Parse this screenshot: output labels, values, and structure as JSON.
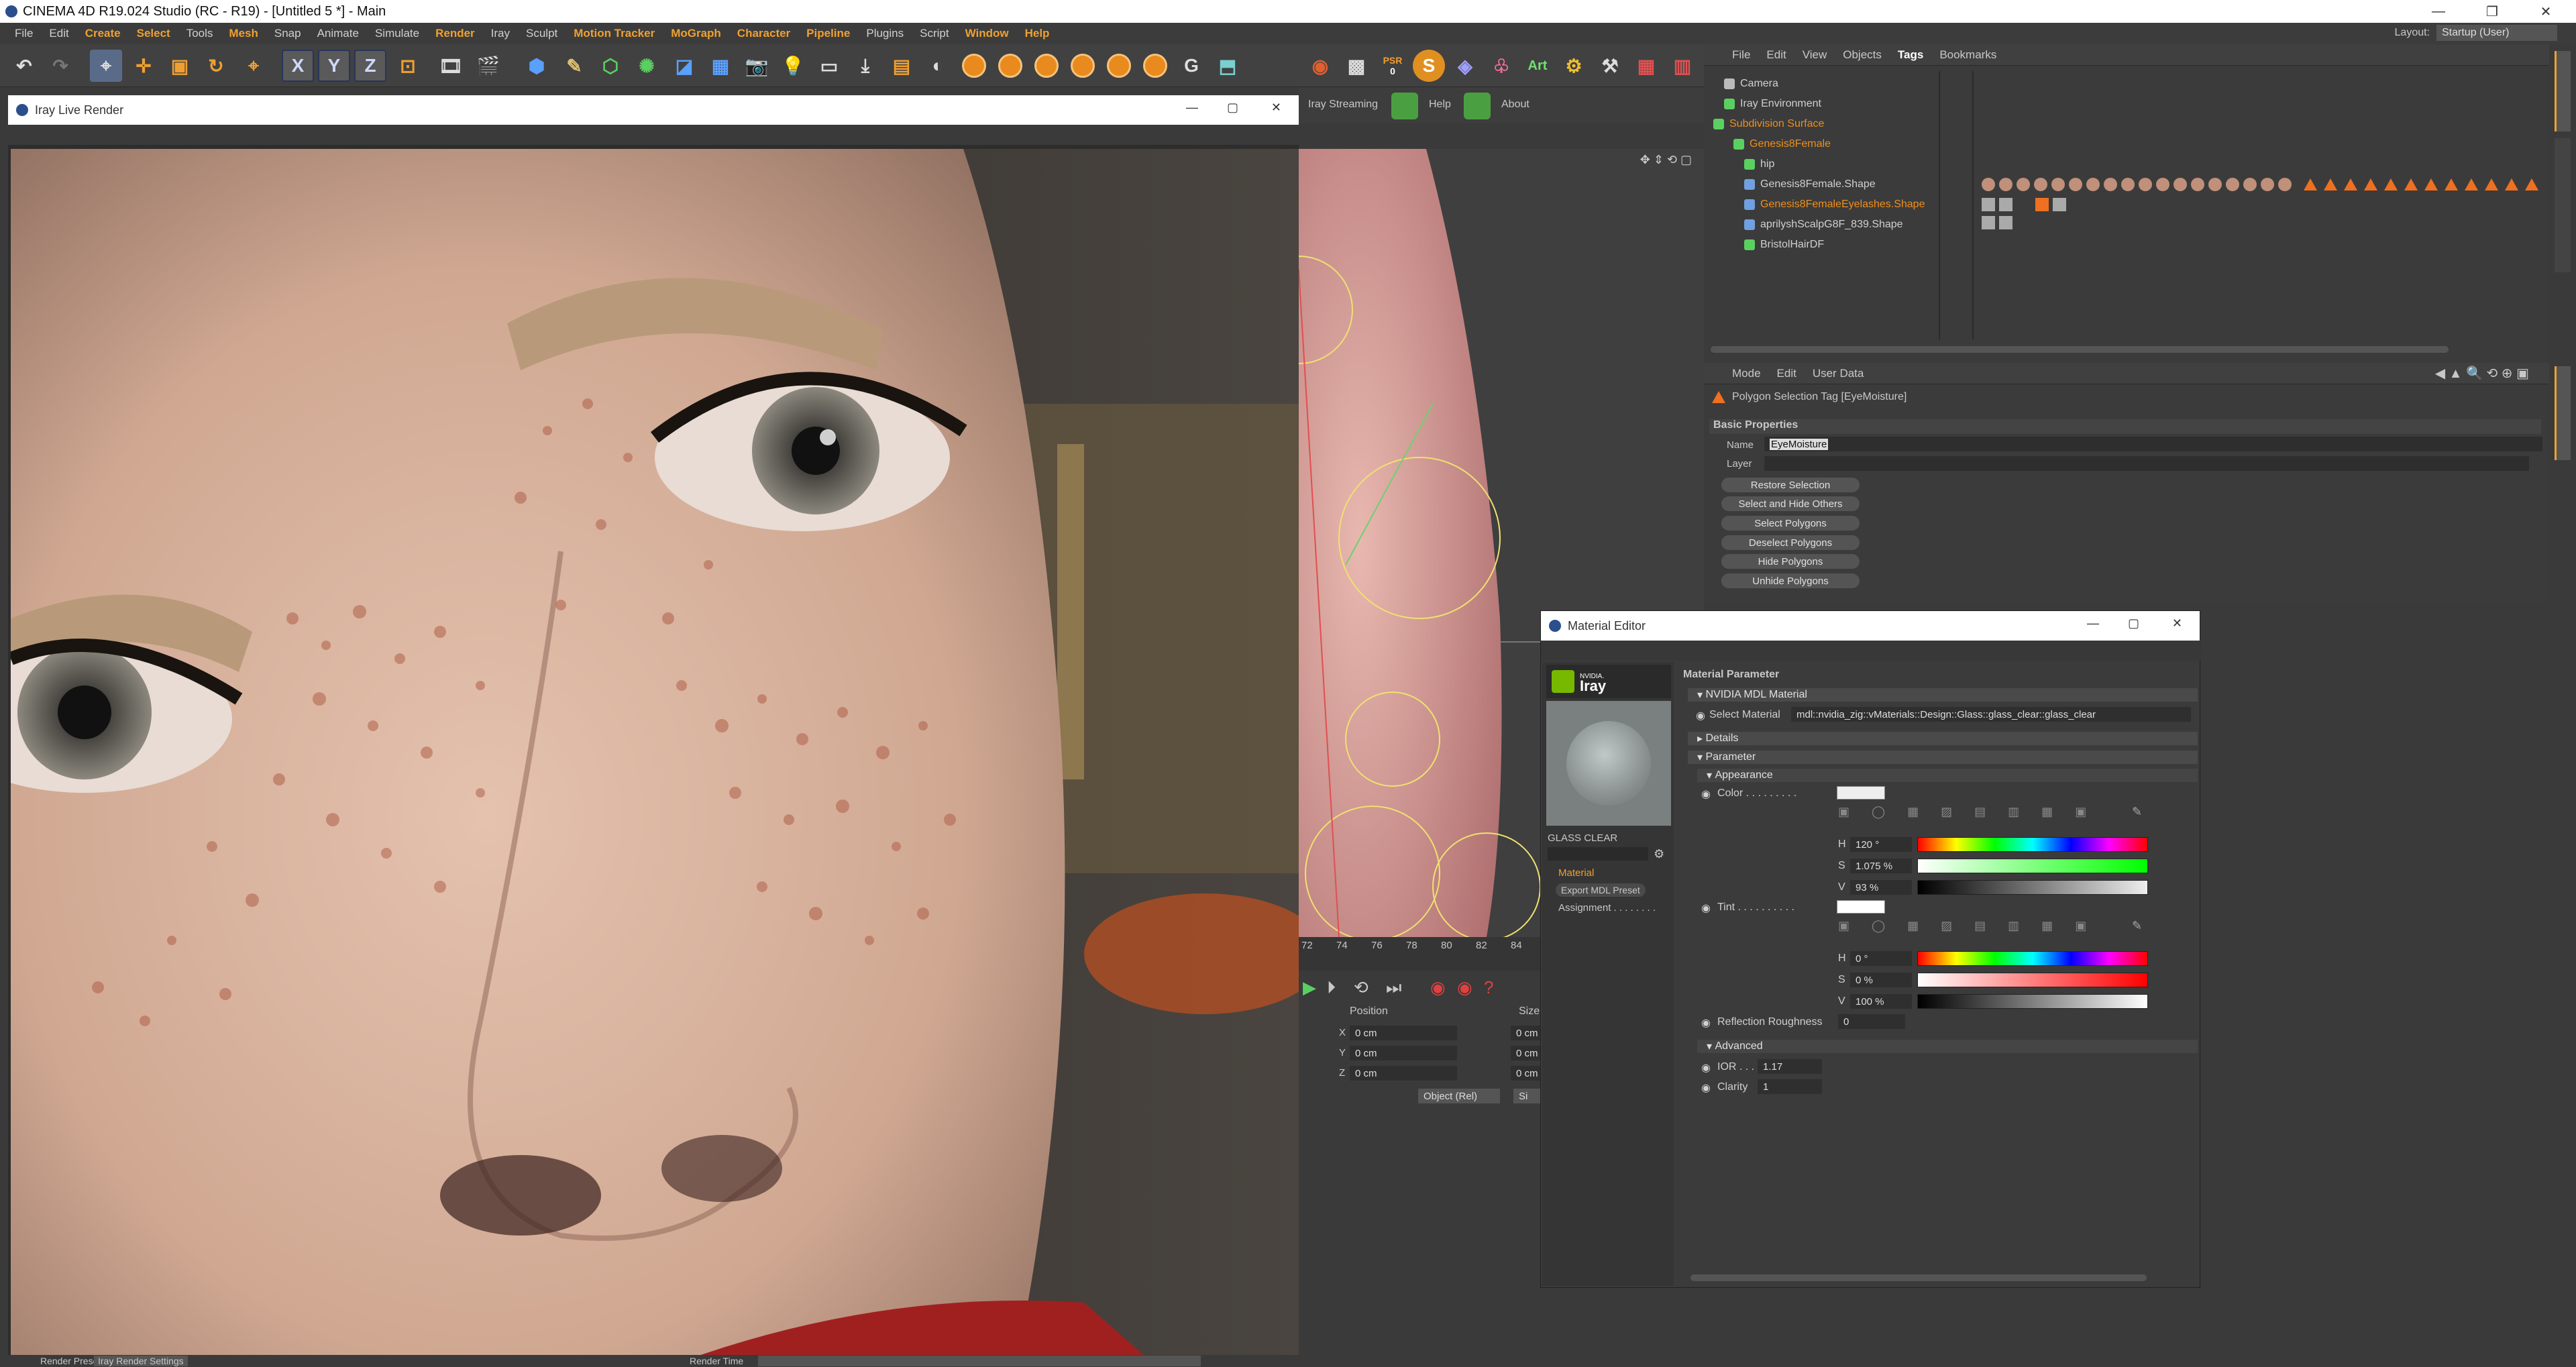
{
  "app": {
    "title": "CINEMA 4D R19.024 Studio (RC - R19) - [Untitled 5 *] - Main"
  },
  "menu": [
    "File",
    "Edit",
    "Create",
    "Select",
    "Tools",
    "Mesh",
    "Snap",
    "Animate",
    "Simulate",
    "Render",
    "Iray",
    "Sculpt",
    "Motion Tracker",
    "MoGraph",
    "Character",
    "Pipeline",
    "Plugins",
    "Script",
    "Window",
    "Help"
  ],
  "menu_highlight": [
    "Create",
    "Select",
    "Mesh",
    "Render",
    "Motion Tracker",
    "MoGraph",
    "Character",
    "Pipeline",
    "Window",
    "Help"
  ],
  "layout": {
    "label": "Layout:",
    "value": "Startup (User)"
  },
  "toolbar": {
    "x": "X",
    "y": "Y",
    "z": "Z",
    "psr": "PSR",
    "psr_num": "0",
    "art": "Art"
  },
  "iray_toolbar": {
    "streaming": "Iray Streaming",
    "help": "Help",
    "about": "About"
  },
  "live_render": {
    "title": "Iray Live Render"
  },
  "obj_menu": [
    "File",
    "Edit",
    "View",
    "Objects",
    "Tags",
    "Bookmarks"
  ],
  "objects": [
    {
      "name": "Camera",
      "orange": false,
      "indent": 0
    },
    {
      "name": "Iray Environment",
      "orange": false,
      "indent": 0
    },
    {
      "name": "Subdivision Surface",
      "orange": true,
      "indent": 0
    },
    {
      "name": "Genesis8Female",
      "orange": true,
      "indent": 1
    },
    {
      "name": "hip",
      "orange": false,
      "indent": 2
    },
    {
      "name": "Genesis8Female.Shape",
      "orange": false,
      "indent": 2
    },
    {
      "name": "Genesis8FemaleEyelashes.Shape",
      "orange": true,
      "indent": 2
    },
    {
      "name": "aprilyshScalpG8F_839.Shape",
      "orange": false,
      "indent": 2
    },
    {
      "name": "BristolHairDF",
      "orange": false,
      "indent": 2
    }
  ],
  "attr_menu": [
    "Mode",
    "Edit",
    "User Data"
  ],
  "attr": {
    "header": "Polygon Selection Tag [EyeMoisture]",
    "section": "Basic Properties",
    "name_label": "Name",
    "name_value": "EyeMoisture",
    "layer_label": "Layer",
    "buttons": [
      "Restore Selection",
      "Select and Hide Others",
      "Select Polygons",
      "Deselect Polygons",
      "Hide Polygons",
      "Unhide Polygons"
    ]
  },
  "timeline": {
    "ticks": [
      "72",
      "74",
      "76",
      "78",
      "80",
      "82",
      "84"
    ]
  },
  "coords": {
    "position": "Position",
    "size": "Size",
    "rows": [
      {
        "axis": "X",
        "pos": "0 cm",
        "size": "0 cm"
      },
      {
        "axis": "Y",
        "pos": "0 cm",
        "size": "0 cm"
      },
      {
        "axis": "Z",
        "pos": "0 cm",
        "size": "0 cm"
      }
    ],
    "mode": "Object (Rel)",
    "apply": "Si"
  },
  "bottom": {
    "render_preset": "Render Preset",
    "iray_render_settings": "Iray Render Settings",
    "render_time": "Render Time"
  },
  "material_editor": {
    "title": "Material Editor",
    "nvidia": "NVIDIA.",
    "iray": "Iray",
    "material_name": "GLASS CLEAR",
    "nav": [
      "Material",
      "Export MDL Preset",
      "Assignment . . . . . . . ."
    ],
    "param_title": "Material Parameter",
    "mdl_section": "NVIDIA MDL Material",
    "select_material_label": "Select Material",
    "select_material_value": "mdl::nvidia_zig::vMaterials::Design::Glass::glass_clear::glass_clear",
    "details": "Details",
    "parameter": "Parameter",
    "appearance": "Appearance",
    "color_label": "Color . . . . . . . . .",
    "color_h": "120 °",
    "color_s": "1.075 %",
    "color_v": "93 %",
    "tint_label": "Tint . . . . . . . . . .",
    "tint_h": "0 °",
    "tint_s": "0 %",
    "tint_v": "100 %",
    "refl_label": "Reflection Roughness",
    "refl_value": "0",
    "advanced": "Advanced",
    "ior_label": "IOR . . .",
    "ior_value": "1.17",
    "clarity_label": "Clarity",
    "clarity_value": "1",
    "hsv_labels": [
      "H",
      "S",
      "V"
    ]
  },
  "colors": {
    "accent": "#ee8f1c",
    "panel": "#3b3b3b",
    "menu": "#3c3c3c",
    "highlight": "#f0a030"
  }
}
